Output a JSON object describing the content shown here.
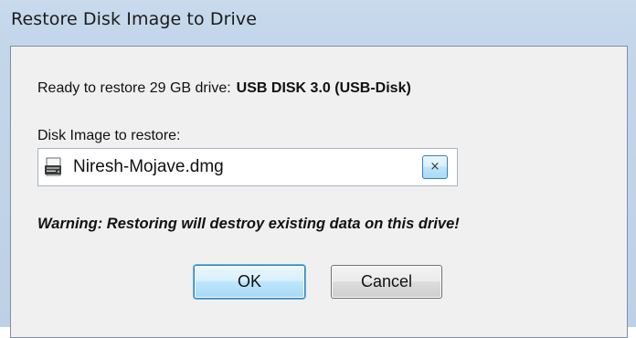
{
  "window": {
    "title": "Restore Disk Image to Drive"
  },
  "status": {
    "ready_text": "Ready to restore 29 GB drive:",
    "drive_name": "USB DISK 3.0 (USB-Disk)"
  },
  "image_field": {
    "label": "Disk Image to restore:",
    "value": "Niresh-Mojave.dmg",
    "icon": "disk-image-file-icon",
    "clear_glyph": "×"
  },
  "warning_text": "Warning: Restoring will destroy existing data on this drive!",
  "buttons": {
    "ok_label": "OK",
    "cancel_label": "Cancel"
  },
  "colors": {
    "titlebar": "#c3d6ea",
    "client_bg": "#f0f0f0",
    "default_button_border": "#3c7fb1"
  }
}
